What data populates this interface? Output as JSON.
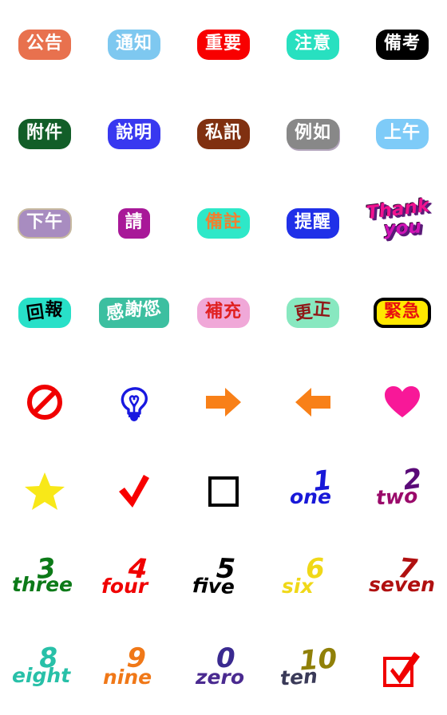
{
  "sheet": {
    "background": "#ffffff",
    "columns": 5,
    "rows": 8,
    "stickers": [
      {
        "id": "gonggao",
        "kind": "pill",
        "text": "公告",
        "name": "sticker-announcement",
        "bg": "#e8714e",
        "fg": "#ffffff"
      },
      {
        "id": "tongzhi",
        "kind": "pill",
        "text": "通知",
        "name": "sticker-notice",
        "bg": "#7ec8f0",
        "fg": "#ffffff"
      },
      {
        "id": "zhongyao",
        "kind": "pill",
        "text": "重要",
        "name": "sticker-important",
        "bg": "#f80000",
        "fg": "#ffffff"
      },
      {
        "id": "zhuyi",
        "kind": "pill",
        "text": "注意",
        "name": "sticker-attention",
        "bg": "#28e0c0",
        "fg": "#ffffff"
      },
      {
        "id": "beikao",
        "kind": "pill",
        "text": "備考",
        "name": "sticker-remark",
        "bg": "#000000",
        "fg": "#ffffff"
      },
      {
        "id": "fujian",
        "kind": "pill",
        "text": "附件",
        "name": "sticker-attachment",
        "bg": "#125e28",
        "fg": "#ffffff"
      },
      {
        "id": "shuoming",
        "kind": "pill",
        "text": "說明",
        "name": "sticker-explanation",
        "bg": "#3838f0",
        "fg": "#ffffff"
      },
      {
        "id": "sixun",
        "kind": "pill",
        "text": "私訊",
        "name": "sticker-direct-message",
        "bg": "#803010",
        "fg": "#ffffff"
      },
      {
        "id": "liru",
        "kind": "pill",
        "text": "例如",
        "name": "sticker-for-example",
        "bg": "#888888",
        "fg": "#ffffff"
      },
      {
        "id": "shangwu",
        "kind": "pill",
        "text": "上午",
        "name": "sticker-morning",
        "bg": "#7ecbf8",
        "fg": "#ffffff"
      },
      {
        "id": "xiawu",
        "kind": "pill",
        "text": "下午",
        "name": "sticker-afternoon",
        "bg": "#a88cc0",
        "fg": "#ffffff"
      },
      {
        "id": "qing",
        "kind": "pill",
        "text": "請",
        "name": "sticker-please",
        "bg": "#a81898",
        "fg": "#ffffff"
      },
      {
        "id": "beizhu",
        "kind": "pill",
        "text": "備註",
        "name": "sticker-note",
        "bg": "#2ee8c8",
        "fg": "#f08030"
      },
      {
        "id": "tixing",
        "kind": "pill",
        "text": "提醒",
        "name": "sticker-reminder",
        "bg": "#2030e8",
        "fg": "#ffffff"
      },
      {
        "id": "thankyou",
        "kind": "thanks",
        "line1": "Thank",
        "line2": "you",
        "name": "sticker-thank-you",
        "fg1": "#f0118f",
        "fg2": "#cf13b5",
        "shadow": "#5b1a78"
      },
      {
        "id": "huibao",
        "kind": "pill",
        "text": "回報",
        "name": "sticker-report-back",
        "bg": "#28e0c8",
        "fg": "#000000"
      },
      {
        "id": "ganxienin",
        "kind": "pill",
        "text": "感謝您",
        "name": "sticker-thank-you-cjk",
        "bg": "#3cbfa0",
        "fg": "#ffffff"
      },
      {
        "id": "buchong",
        "kind": "pill",
        "text": "補充",
        "name": "sticker-supplement",
        "bg": "#f0a8d8",
        "fg": "#e02020"
      },
      {
        "id": "gengzheng",
        "kind": "pill",
        "text": "更正",
        "name": "sticker-correction",
        "bg": "#88e8c0",
        "fg": "#901818"
      },
      {
        "id": "jinji",
        "kind": "pill",
        "text": "緊急",
        "name": "sticker-urgent",
        "bg": "#ffe800",
        "fg": "#e81010",
        "border": "#000000"
      },
      {
        "id": "prohibit",
        "kind": "symbol",
        "symbol": "prohibition-sign",
        "name": "sticker-prohibited",
        "fg": "#f00000"
      },
      {
        "id": "bulb",
        "kind": "symbol",
        "symbol": "lightbulb",
        "name": "sticker-idea",
        "fg": "#1818e0"
      },
      {
        "id": "arrowr",
        "kind": "symbol",
        "symbol": "arrow-right",
        "name": "sticker-arrow-right",
        "fg": "#f88018"
      },
      {
        "id": "arrowl",
        "kind": "symbol",
        "symbol": "arrow-left",
        "name": "sticker-arrow-left",
        "fg": "#f88018"
      },
      {
        "id": "heart",
        "kind": "symbol",
        "symbol": "heart",
        "name": "sticker-heart",
        "fg": "#f81898"
      },
      {
        "id": "star",
        "kind": "symbol",
        "symbol": "star",
        "name": "sticker-star",
        "fg": "#f8e818"
      },
      {
        "id": "check",
        "kind": "symbol",
        "symbol": "check-mark",
        "name": "sticker-check-mark",
        "fg": "#f80000"
      },
      {
        "id": "box",
        "kind": "symbol",
        "symbol": "empty-checkbox",
        "name": "sticker-empty-box",
        "fg": "#000000"
      },
      {
        "id": "one",
        "kind": "number",
        "digit": "1",
        "word": "one",
        "name": "sticker-number-one",
        "digit_color": "#1818d8",
        "word_color": "#1818d8"
      },
      {
        "id": "two",
        "kind": "number",
        "digit": "2",
        "word": "two",
        "name": "sticker-number-two",
        "digit_color": "#5a0a78",
        "word_color": "#9a0a6a"
      },
      {
        "id": "three",
        "kind": "number",
        "digit": "3",
        "word": "three",
        "name": "sticker-number-three",
        "digit_color": "#0c7a18",
        "word_color": "#0c7a18"
      },
      {
        "id": "four",
        "kind": "number",
        "digit": "4",
        "word": "four",
        "name": "sticker-number-four",
        "digit_color": "#f00000",
        "word_color": "#f00000"
      },
      {
        "id": "five",
        "kind": "number",
        "digit": "5",
        "word": "five",
        "name": "sticker-number-five",
        "digit_color": "#000000",
        "word_color": "#000000"
      },
      {
        "id": "six",
        "kind": "number",
        "digit": "6",
        "word": "six",
        "name": "sticker-number-six",
        "digit_color": "#f0d818",
        "word_color": "#f0d818"
      },
      {
        "id": "seven",
        "kind": "number",
        "digit": "7",
        "word": "seven",
        "name": "sticker-number-seven",
        "digit_color": "#b01010",
        "word_color": "#b01010"
      },
      {
        "id": "eight",
        "kind": "number",
        "digit": "8",
        "word": "eight",
        "name": "sticker-number-eight",
        "digit_color": "#28c0a8",
        "word_color": "#28c0a8"
      },
      {
        "id": "nine",
        "kind": "number",
        "digit": "9",
        "word": "nine",
        "name": "sticker-number-nine",
        "digit_color": "#f07818",
        "word_color": "#f07818"
      },
      {
        "id": "zero",
        "kind": "number",
        "digit": "0",
        "word": "zero",
        "name": "sticker-number-zero",
        "digit_color": "#3a2a90",
        "word_color": "#4a2a90"
      },
      {
        "id": "ten",
        "kind": "number",
        "digit": "10",
        "word": "ten",
        "name": "sticker-number-ten",
        "digit_color": "#908008",
        "word_color": "#3a3a58"
      },
      {
        "id": "checkbox",
        "kind": "symbol",
        "symbol": "checked-checkbox",
        "name": "sticker-checked-box",
        "fg": "#f00000"
      }
    ]
  }
}
